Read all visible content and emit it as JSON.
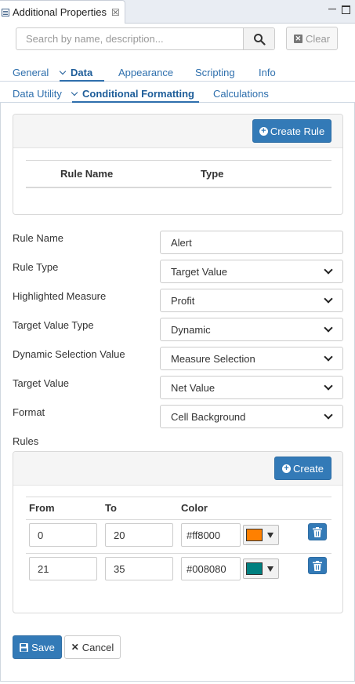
{
  "window": {
    "tab_title": "Additional Properties"
  },
  "search": {
    "placeholder": "Search by name, description...",
    "clear_label": "Clear"
  },
  "nav_tabs": [
    {
      "label": "General"
    },
    {
      "label": "Data",
      "active": true
    },
    {
      "label": "Appearance"
    },
    {
      "label": "Scripting"
    },
    {
      "label": "Info"
    }
  ],
  "sub_tabs": [
    {
      "label": "Data Utility"
    },
    {
      "label": "Conditional Formatting",
      "active": true
    },
    {
      "label": "Calculations"
    }
  ],
  "rules_table": {
    "create_rule_label": "Create Rule",
    "columns": [
      "Rule Name",
      "Type"
    ],
    "rows": []
  },
  "form": {
    "rule_name": {
      "label": "Rule Name",
      "value": "Alert"
    },
    "rule_type": {
      "label": "Rule Type",
      "value": "Target Value"
    },
    "highlighted_measure": {
      "label": "Highlighted Measure",
      "value": "Profit"
    },
    "target_value_type": {
      "label": "Target Value Type",
      "value": "Dynamic"
    },
    "dynamic_selection_value": {
      "label": "Dynamic Selection Value",
      "value": "Measure Selection"
    },
    "target_value": {
      "label": "Target Value",
      "value": "Net Value"
    },
    "format": {
      "label": "Format",
      "value": "Cell Background"
    }
  },
  "rules": {
    "title": "Rules",
    "create_label": "Create",
    "columns": [
      "From",
      "To",
      "Color"
    ],
    "rows": [
      {
        "from": "0",
        "to": "20",
        "color": "#ff8000"
      },
      {
        "from": "21",
        "to": "35",
        "color": "#008080"
      }
    ]
  },
  "actions": {
    "save_label": "Save",
    "cancel_label": "Cancel"
  },
  "colors": {
    "primary": "#337ab7",
    "link": "#2e6fad"
  }
}
